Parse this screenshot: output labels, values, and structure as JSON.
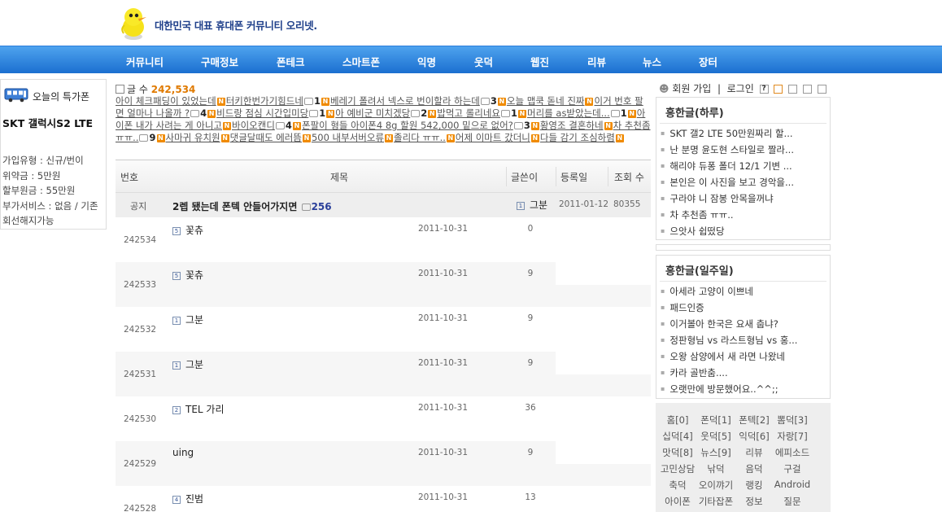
{
  "header": {
    "tagline": "대한민국 대표 휴대폰 커뮤니티 오리넷.",
    "logo_icon": "duck-logo-icon"
  },
  "nav": [
    "커뮤니티",
    "구매정보",
    "폰테크",
    "스마트폰",
    "익명",
    "웃덕",
    "웹진",
    "리뷰",
    "뉴스",
    "장터"
  ],
  "special": {
    "title": "오늘의 특가폰",
    "phone": "SKT 갤럭시S2 LTE",
    "info": "가입유형 : 신규/번이\n위약금 : 5만원\n할부원금 : 55만원\n부가서비스 : 없음 / 기존회선해지가능"
  },
  "count": {
    "label": "글 수",
    "value": "242,534"
  },
  "ticker": [
    {
      "t": "아이 체크패딩이 있었는데",
      "n": true
    },
    {
      "t": "터키한번가기힘드네",
      "n": false,
      "c": "1",
      "n2": true
    },
    {
      "t": "베레기 폴려서 넥스로 번이할라 하는데",
      "c": "3",
      "n2": true
    },
    {
      "t": "오늘 맵쿡 돋네 진짜",
      "n": true
    },
    {
      "t": "이거 번호 팔면 얼마나 나올까 ?",
      "c": "4",
      "n2": true
    },
    {
      "t": "비드랑 점심 시간입미당",
      "c": "1",
      "n2": true
    },
    {
      "t": "아 예비군 미치겠당",
      "c": "2",
      "n2": true
    },
    {
      "t": "밥먹고 롤리네요",
      "c": "1",
      "n2": true
    },
    {
      "t": "머리를 as받았는데...",
      "c": "1",
      "n2": true
    },
    {
      "t": "아이폰 내가 사려는 게 아니고",
      "n": true
    },
    {
      "t": "바이오캔디",
      "c": "4",
      "n2": true
    },
    {
      "t": "폰팔이 형들 아이폰4 8g 할원 542,000 밑으로 없어?",
      "c": "3",
      "n2": true
    },
    {
      "t": "황영조 결혼하네",
      "n": true
    },
    {
      "t": "차 추천좀 ㅠㅠ..",
      "c": "9",
      "n2": true
    },
    {
      "t": "사마귀 유치원",
      "n": true
    },
    {
      "t": "댓글달때도 에러뜸",
      "n": true
    },
    {
      "t": "500 내부서버오류",
      "n": true
    },
    {
      "t": "졸리다 ㅠㅠ..",
      "n": true
    },
    {
      "t": "어제 이마트 갔더니",
      "n": true
    },
    {
      "t": "다들 감기 조심하렴",
      "n": true
    }
  ],
  "board": {
    "columns": {
      "no": "번호",
      "title": "제목",
      "writer": "글쓴이",
      "date": "등록일",
      "hits": "조회 수"
    },
    "notice": {
      "label": "공지",
      "title": "2렙 됐는데 폰텍 안들어가지면",
      "comments": "256",
      "level": "1",
      "writer": "그분",
      "date": "2011-01-12",
      "hits": "80355"
    },
    "rows": [
      {
        "no": "242534",
        "level": "5",
        "title": "꽃츄",
        "date": "2011-10-31",
        "hits": "0"
      },
      {
        "no": "242533",
        "level": "5",
        "title": "꽃츄",
        "date": "2011-10-31",
        "hits": "9"
      },
      {
        "no": "242532",
        "level": "1",
        "title": "그분",
        "date": "2011-10-31",
        "hits": "9"
      },
      {
        "no": "242531",
        "level": "1",
        "title": "그분",
        "date": "2011-10-31",
        "hits": "9"
      },
      {
        "no": "242530",
        "level": "2",
        "title": "TEL 가리",
        "date": "2011-10-31",
        "hits": "36"
      },
      {
        "no": "242529",
        "level": "",
        "title": "uing",
        "date": "2011-10-31",
        "hits": "9"
      },
      {
        "no": "242528",
        "level": "4",
        "title": "진범",
        "date": "2011-10-31",
        "hits": "13"
      }
    ]
  },
  "member": {
    "join": "회원 가입",
    "login": "로그인",
    "help": "?"
  },
  "hot_daily": {
    "title": "흥한글(하루)",
    "items": [
      "SKT 갤2 LTE 50만원짜리 할...",
      "난 분명 윤도현 스타일로 짤라...",
      "해리야 듀퐁 폴더 12/1 기변 ...",
      "본인은 이 사진을 보고 경악을...",
      "구라야 니 잠봉 안목을꺼냐",
      "차 추천좀 ㅠㅠ..",
      "으앗사 쉽떴당"
    ]
  },
  "hot_weekly": {
    "title": "흥한글(일주일)",
    "items": [
      "아세라 고양이 이쁘네",
      "패드인증",
      "이거볼아 한국은 요새 춥냐?",
      "정판형님 vs 라스트형님 vs 홍...",
      "오왕 삼양에서 새 라면 나왔네",
      "카라 골반춤....",
      "오랫만에 방문했어요..^^;;"
    ]
  },
  "categories": [
    "홈[0]",
    "폰덕[1]",
    "폰텍[2]",
    "뽐덕[3]",
    "십덕[4]",
    "웃덕[5]",
    "익덕[6]",
    "자랑[7]",
    "맛덕[8]",
    "뉴스[9]",
    "리뷰",
    "에피소드",
    "고민상담",
    "낚덕",
    "음덕",
    "구걸",
    "축덕",
    "오이꺄기",
    "랭킹",
    "Android",
    "아이폰",
    "기타잡폰",
    "정보",
    "질문"
  ],
  "colors": {
    "nav_top": "#4ea3ee",
    "nav_bottom": "#1b6fd0",
    "accent": "#e07a00"
  }
}
